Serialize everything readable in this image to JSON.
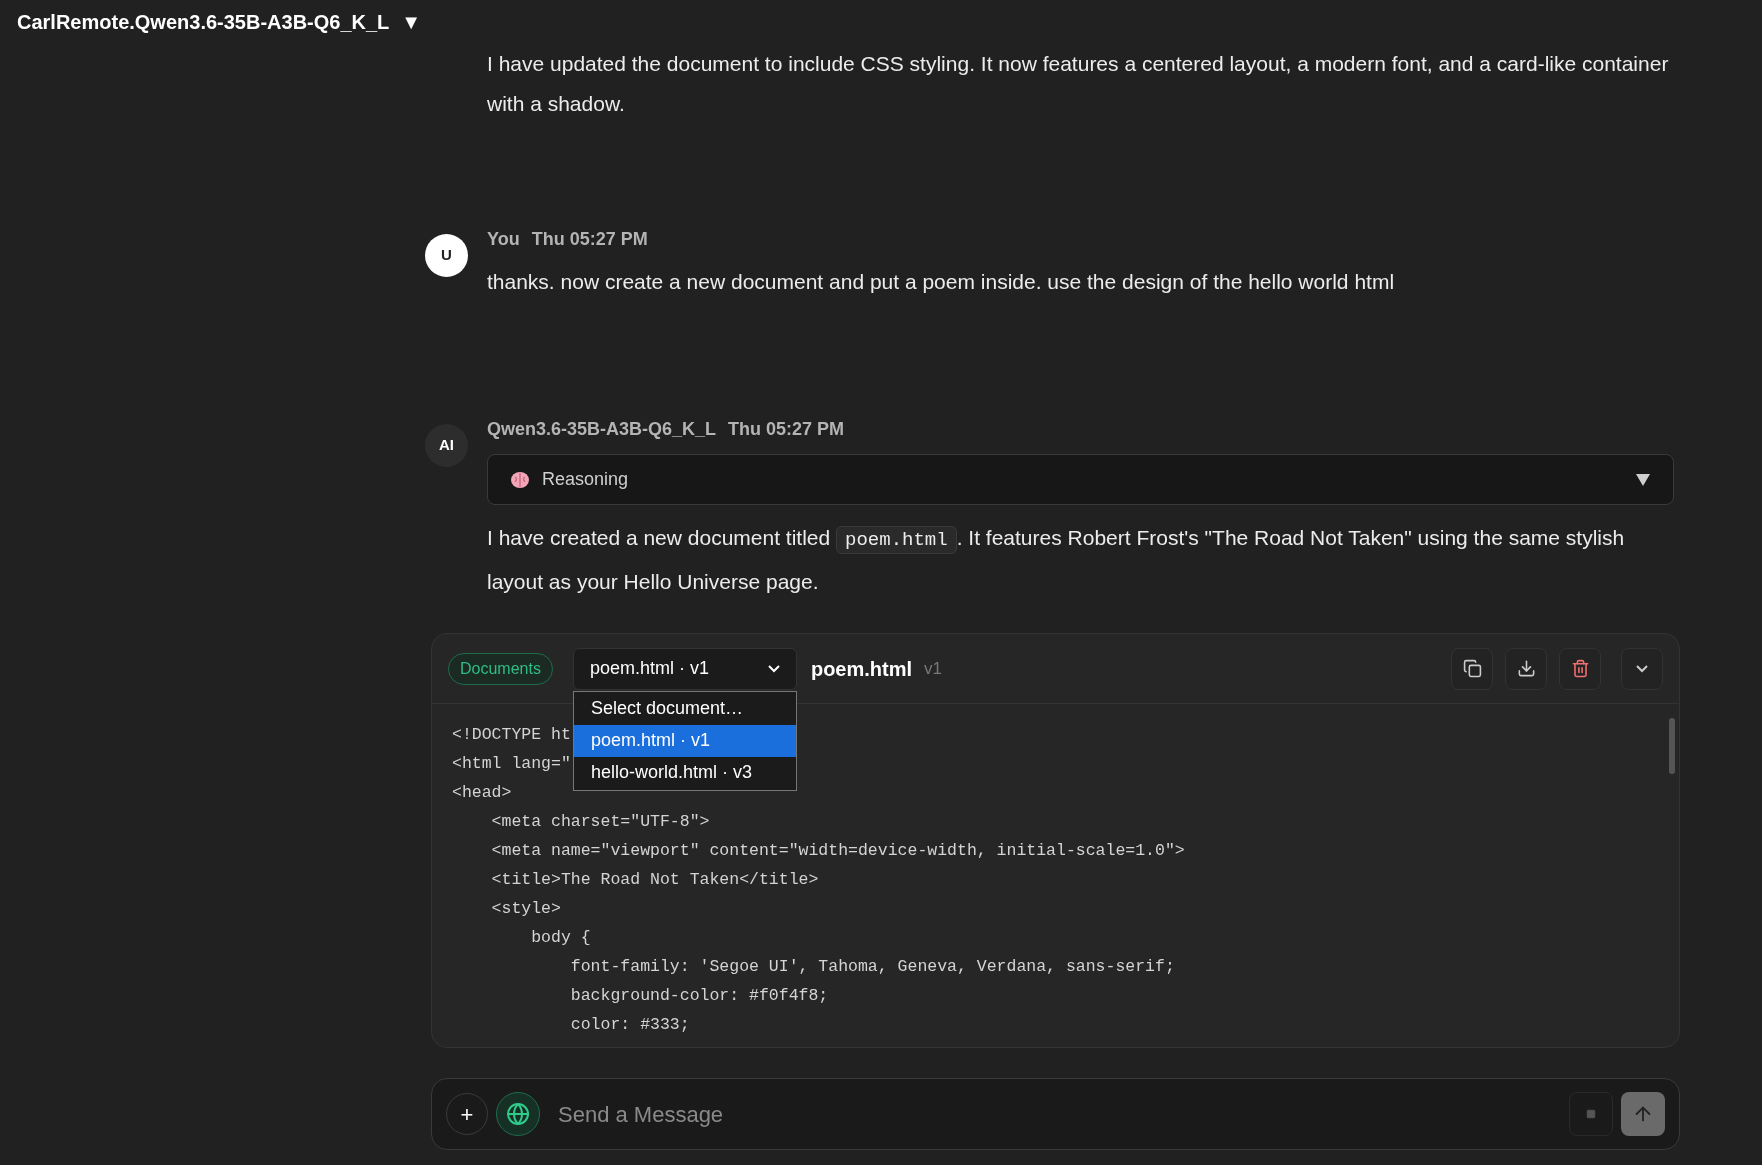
{
  "header": {
    "model": "CarlRemote.Qwen3.6-35B-A3B-Q6_K_L",
    "caret": "▼"
  },
  "messages": [
    {
      "kind": "assistant_tail",
      "paragraphs": [
        "I have updated the document to include CSS styling. It now features a centered layout, a modern font, and a card-like container with a shadow."
      ]
    },
    {
      "kind": "user",
      "avatar": "U",
      "author": "You",
      "time": "Thu 05:27 PM",
      "text": "thanks. now create a new document and put a poem inside. use the design of the hello world html"
    },
    {
      "kind": "assistant",
      "avatar": "AI",
      "author": "Qwen3.6-35B-A3B-Q6_K_L",
      "time": "Thu 05:27 PM",
      "reasoning": {
        "label": "Reasoning",
        "expanded": false
      },
      "text_before": "I have created a new document titled ",
      "code": "poem.html",
      "text_after": ". It features Robert Frost's \"The Road Not Taken\" using the same stylish layout as your Hello Universe page."
    }
  ],
  "document_panel": {
    "tag": "Documents",
    "select_value": "poem.html · v1",
    "title": "poem.html",
    "version": "v1",
    "menu": [
      {
        "label": "Select document…",
        "selected": false
      },
      {
        "label": "poem.html · v1",
        "selected": true
      },
      {
        "label": "hello-world.html · v3",
        "selected": false
      }
    ],
    "code_lines": [
      "<!DOCTYPE ht",
      "<html lang=\"",
      "<head>",
      "    <meta charset=\"UTF-8\">",
      "    <meta name=\"viewport\" content=\"width=device-width, initial-scale=1.0\">",
      "    <title>The Road Not Taken</title>",
      "    <style>",
      "        body {",
      "            font-family: 'Segoe UI', Tahoma, Geneva, Verdana, sans-serif;",
      "            background-color: #f0f4f8;",
      "            color: #333;"
    ]
  },
  "composer": {
    "placeholder": "Send a Message",
    "plus": "+"
  }
}
